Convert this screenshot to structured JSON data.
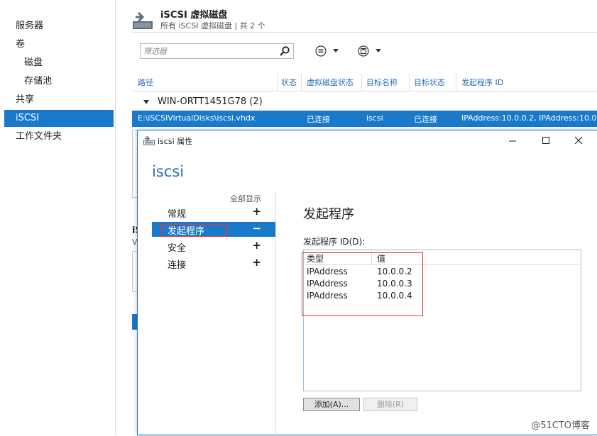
{
  "nav": {
    "items": [
      {
        "label": "服务器"
      },
      {
        "label": "卷"
      },
      {
        "label": "磁盘"
      },
      {
        "label": "存储池"
      },
      {
        "label": "共享"
      },
      {
        "label": "iSCSI"
      },
      {
        "label": "工作文件夹"
      }
    ]
  },
  "header": {
    "title": "iSCSI 虚拟磁盘",
    "subtitle": "所有 iSCSI 虚拟磁盘 | 共 2 个"
  },
  "toolbar": {
    "filter_placeholder": "筛选器"
  },
  "table": {
    "columns": [
      "路径",
      "状态",
      "虚拟磁盘状态",
      "目标名称",
      "目标状态",
      "发起程序 ID"
    ],
    "group_label": "WIN-ORTT1451G78 (2)",
    "selected_row": {
      "path": "E:\\iSCSIVirtualDisks\\iscsi.vhdx",
      "disk_status": "已连接",
      "target_name": "iscsi",
      "target_status": "已连接",
      "initiator_id": "IPAddress:10.0.0.2, IPAddress:10.0"
    }
  },
  "background_fragments": {
    "label_i": "iS",
    "label_v": "V"
  },
  "dialog": {
    "title": "iscsi 属性",
    "heading": "iscsi",
    "show_all": "全部显示",
    "sections": [
      {
        "label": "常规",
        "symbol": "+"
      },
      {
        "label": "发起程序",
        "symbol": "−"
      },
      {
        "label": "安全",
        "symbol": "+"
      },
      {
        "label": "连接",
        "symbol": "+"
      }
    ],
    "section_title": "发起程序",
    "initiator_label": "发起程序 ID(D):",
    "list_headers": {
      "type": "类型",
      "value": "值"
    },
    "initiators": [
      {
        "type": "IPAddress",
        "value": "10.0.0.2"
      },
      {
        "type": "IPAddress",
        "value": "10.0.0.3"
      },
      {
        "type": "IPAddress",
        "value": "10.0.0.4"
      }
    ],
    "add_label": "添加(A)...",
    "remove_label": "删除(R)"
  },
  "watermark": "@51CTO博客",
  "colors": {
    "accent": "#1979ca",
    "highlight_box": "#e03a3a"
  }
}
